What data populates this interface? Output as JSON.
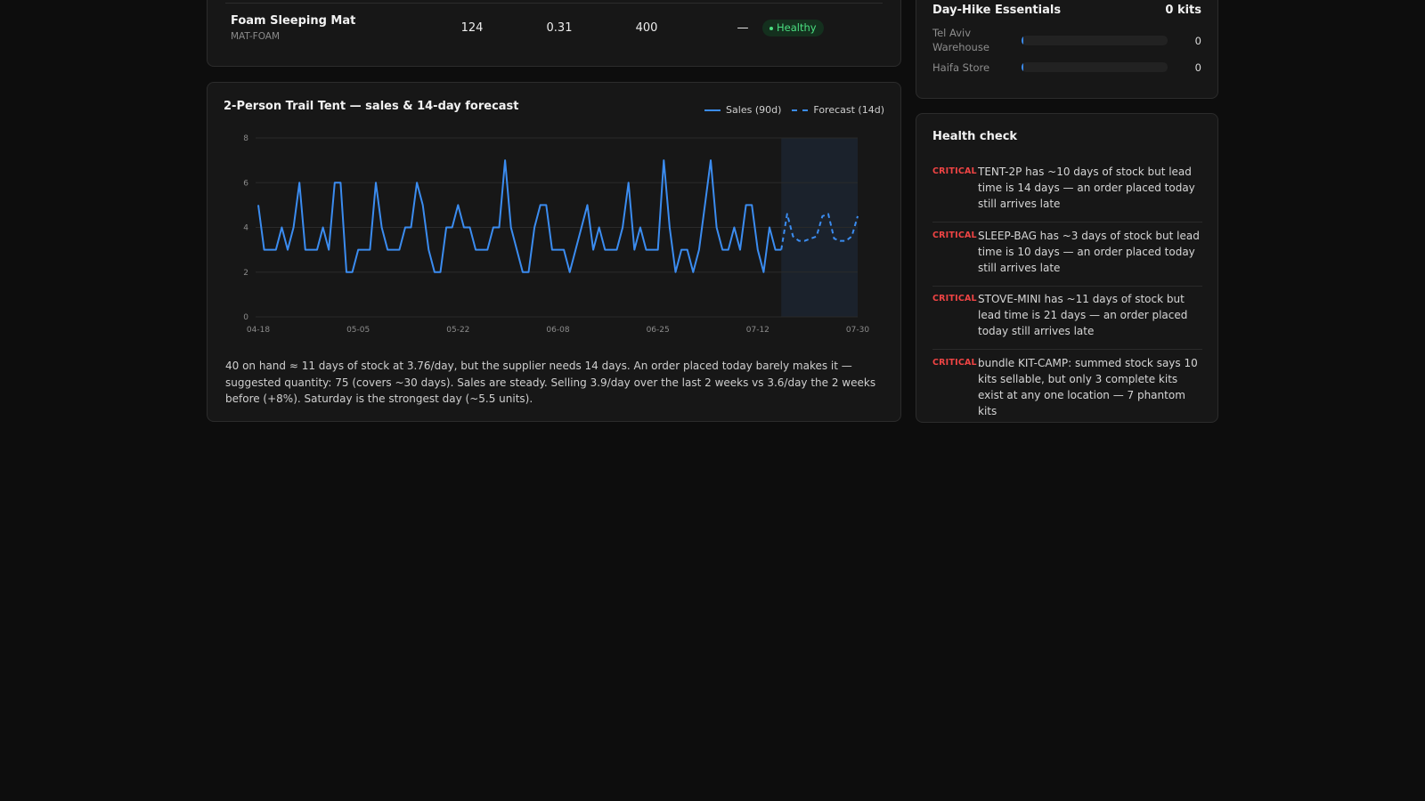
{
  "products_table": {
    "row": {
      "name": "Foam Sleeping Mat",
      "sku": "MAT-FOAM",
      "col1": "124",
      "col2": "0.31",
      "col3": "400",
      "col4": "—",
      "status": "Healthy"
    }
  },
  "forecast_card": {
    "title": "2-Person Trail Tent — sales & 14-day forecast",
    "legend": {
      "sales": "Sales (90d)",
      "forecast": "Forecast (14d)"
    },
    "summary": "40 on hand ≈ 11 days of stock at 3.76/day, but the supplier needs 14 days. An order placed today barely makes it — suggested quantity: 75 (covers ~30 days). Sales are steady. Selling 3.9/day over the last 2 weeks vs 3.6/day the 2 weeks before (+8%). Saturday is the strongest day (~5.5 units).",
    "colors": {
      "line": "#3b8cf0",
      "forecast_bg": "#1c2430",
      "grid": "#2a2a2a"
    }
  },
  "chart_data": {
    "type": "line",
    "xlabel": "",
    "ylabel": "",
    "ylim": [
      0,
      8
    ],
    "yticks": [
      "0",
      "2",
      "4",
      "6",
      "8"
    ],
    "x_tick_labels": [
      "04-18",
      "05-05",
      "05-22",
      "06-08",
      "06-25",
      "07-12",
      "07-30"
    ],
    "series": [
      {
        "name": "Sales (90d)",
        "style": "solid",
        "values": [
          5,
          3,
          3,
          3,
          4,
          3,
          4,
          6,
          3,
          3,
          3,
          4,
          3,
          6,
          6,
          2,
          2,
          3,
          3,
          3,
          6,
          4,
          3,
          3,
          3,
          4,
          4,
          6,
          5,
          3,
          2,
          2,
          4,
          4,
          5,
          4,
          4,
          3,
          3,
          3,
          4,
          4,
          7,
          4,
          3,
          2,
          2,
          4,
          5,
          5,
          3,
          3,
          3,
          2,
          3,
          4,
          5,
          3,
          4,
          3,
          3,
          3,
          4,
          6,
          3,
          4,
          3,
          3,
          3,
          7,
          4,
          2,
          3,
          3,
          2,
          3,
          5,
          7,
          4,
          3,
          3,
          4,
          3,
          5,
          5,
          3,
          2,
          4,
          3,
          3
        ]
      },
      {
        "name": "Forecast (14d)",
        "style": "dashed",
        "values": [
          3,
          4.6,
          3.6,
          3.4,
          3.4,
          3.5,
          3.6,
          4.5,
          4.6,
          3.5,
          3.4,
          3.4,
          3.6,
          4.5
        ]
      }
    ],
    "legend": "top-right",
    "grid": true
  },
  "kit_card": {
    "title": "Day-Hike Essentials",
    "count": "0 kits",
    "locations": [
      {
        "name": "Tel Aviv Warehouse",
        "value": "0",
        "level": 0
      },
      {
        "name": "Haifa Store",
        "value": "0",
        "level": 0
      }
    ]
  },
  "health_check": {
    "title": "Health check",
    "items": [
      {
        "severity": "CRITICAL",
        "message": "TENT-2P has ~10 days of stock but lead time is 14 days — an order placed today still arrives late"
      },
      {
        "severity": "CRITICAL",
        "message": "SLEEP-BAG has ~3 days of stock but lead time is 10 days — an order placed today still arrives late"
      },
      {
        "severity": "CRITICAL",
        "message": "STOVE-MINI has ~11 days of stock but lead time is 21 days — an order placed today still arrives late"
      },
      {
        "severity": "CRITICAL",
        "message": "bundle KIT-CAMP: summed stock says 10 kits sellable, but only 3 complete kits exist at any one location — 7 phantom kits"
      }
    ]
  }
}
